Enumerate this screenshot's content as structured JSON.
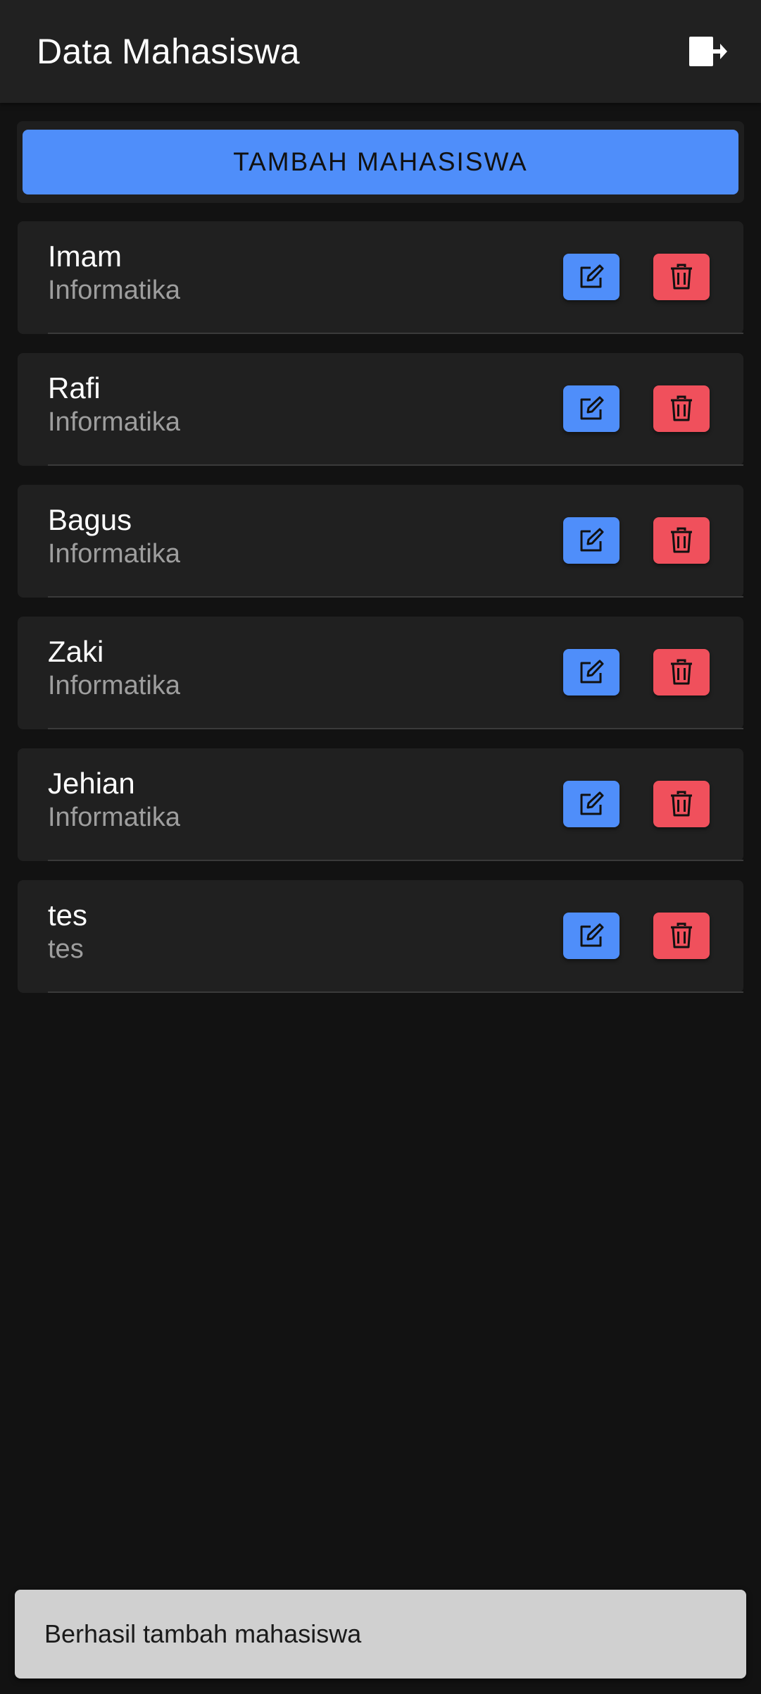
{
  "header": {
    "title": "Data Mahasiswa",
    "logout_icon": "logout-icon"
  },
  "actions": {
    "add_label": "TAMBAH MAHASISWA"
  },
  "students": [
    {
      "name": "Imam",
      "major": "Informatika"
    },
    {
      "name": "Rafi",
      "major": "Informatika"
    },
    {
      "name": "Bagus",
      "major": "Informatika"
    },
    {
      "name": "Zaki",
      "major": "Informatika"
    },
    {
      "name": "Jehian",
      "major": "Informatika"
    },
    {
      "name": "tes",
      "major": "tes"
    }
  ],
  "row_icons": {
    "edit": "edit-icon",
    "delete": "trash-icon"
  },
  "snackbar": {
    "message": "Berhasil tambah mahasiswa"
  },
  "colors": {
    "background": "#121212",
    "appbar": "#212121",
    "card": "#202020",
    "accent_blue": "#4f8efa",
    "danger_red": "#f0505c",
    "snackbar": "#d0d0d0"
  }
}
